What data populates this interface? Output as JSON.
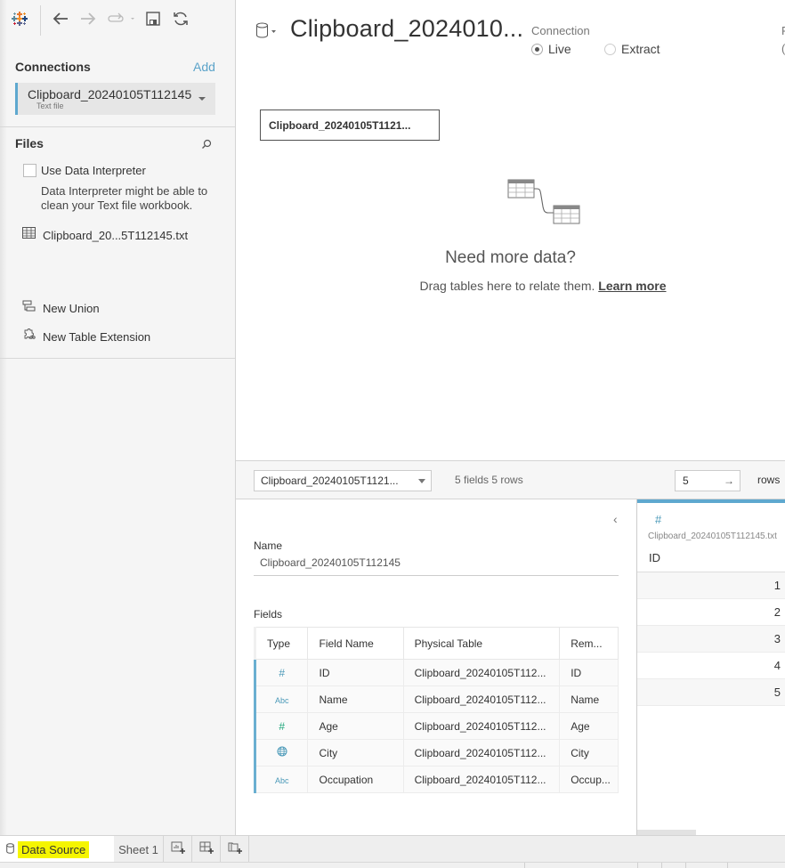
{
  "toolbar": {
    "icons": [
      "tableau-logo-icon",
      "back-arrow-icon",
      "forward-arrow-icon",
      "pause-updates-icon",
      "save-icon",
      "refresh-icon"
    ]
  },
  "connections": {
    "title": "Connections",
    "add_label": "Add",
    "items": [
      {
        "name": "Clipboard_20240105T112145",
        "type": "Text file"
      }
    ]
  },
  "files": {
    "title": "Files",
    "use_interpreter_label": "Use Data Interpreter",
    "use_interpreter_checked": false,
    "interpreter_note": "Data Interpreter might be able to clean your Text file workbook.",
    "items": [
      {
        "name": "Clipboard_20...5T112145.txt",
        "icon": "table-grid-icon"
      }
    ],
    "new_union_label": "New Union",
    "new_table_extension_label": "New Table Extension"
  },
  "datasource": {
    "title": "Clipboard_2024010...",
    "connection_label": "Connection",
    "connection_options": [
      {
        "label": "Live",
        "selected": true
      },
      {
        "label": "Extract",
        "selected": false
      }
    ],
    "cut_off_label": "F",
    "cut_off_value": "("
  },
  "canvas": {
    "table_card_label": "Clipboard_20240105T1121...",
    "need_more_title": "Need more data?",
    "drag_hint": "Drag tables here to relate them.",
    "learn_more_label": "Learn more"
  },
  "grid_bar": {
    "table_select_value": "Clipboard_20240105T1121...",
    "fields_rows_summary": "5 fields 5 rows",
    "rows_input_value": "5",
    "rows_label": "rows"
  },
  "metadata": {
    "name_label": "Name",
    "name_value": "Clipboard_20240105T112145",
    "fields_label": "Fields",
    "columns": [
      "Type",
      "Field Name",
      "Physical Table",
      "Rem..."
    ],
    "rows": [
      {
        "type": "#",
        "type_icon": "number-icon",
        "field": "ID",
        "table": "Clipboard_20240105T112...",
        "remote": "ID"
      },
      {
        "type": "Abc",
        "type_icon": "string-icon",
        "field": "Name",
        "table": "Clipboard_20240105T112...",
        "remote": "Name"
      },
      {
        "type": "#",
        "type_icon": "number-icon",
        "field": "Age",
        "table": "Clipboard_20240105T112...",
        "remote": "Age"
      },
      {
        "type": "🌐",
        "type_icon": "geographic-icon",
        "field": "City",
        "table": "Clipboard_20240105T112...",
        "remote": "City"
      },
      {
        "type": "Abc",
        "type_icon": "string-icon",
        "field": "Occupation",
        "table": "Clipboard_20240105T112...",
        "remote": "Occup..."
      }
    ]
  },
  "preview": {
    "column_type": "#",
    "column_source": "Clipboard_20240105T112145.txt",
    "column_name": "ID",
    "values": [
      "1",
      "2",
      "3",
      "4",
      "5"
    ]
  },
  "tabs": {
    "data_source_label": "Data Source",
    "sheet_label": "Sheet 1",
    "new_sheet_icons": [
      "new-worksheet-icon",
      "new-dashboard-icon",
      "new-story-icon"
    ]
  },
  "colors": {
    "accent_blue": "#5ea8cf",
    "number_type": "#4a99b8",
    "measure_green": "#1da67a",
    "highlight_yellow": "#f5f500"
  }
}
